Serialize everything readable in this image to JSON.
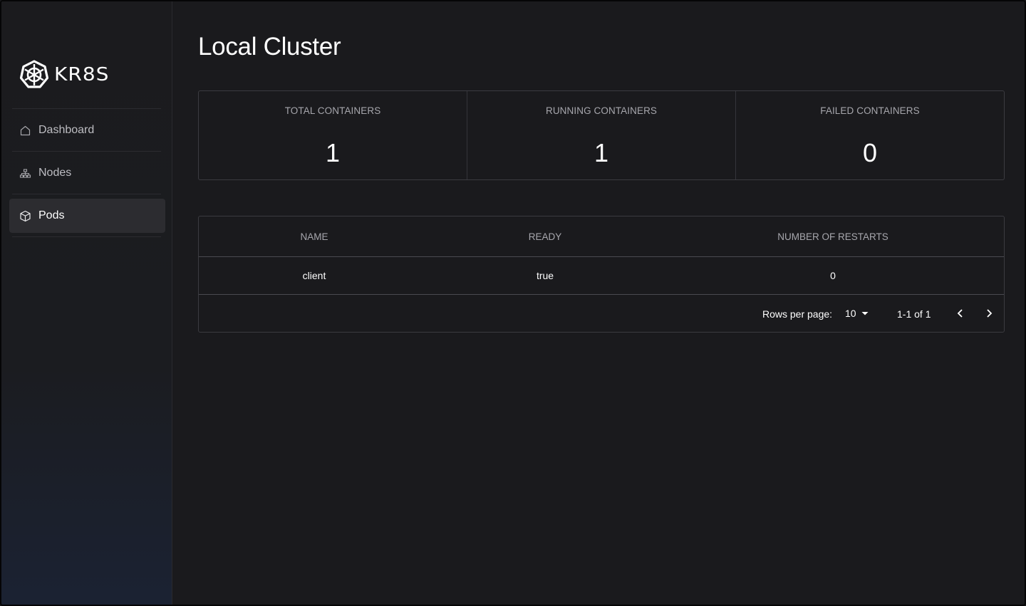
{
  "brand": {
    "logo_text": "KR8S"
  },
  "sidebar": {
    "items": [
      {
        "label": "Dashboard",
        "icon": "home-icon",
        "active": false
      },
      {
        "label": "Nodes",
        "icon": "nodes-icon",
        "active": false
      },
      {
        "label": "Pods",
        "icon": "cube-icon",
        "active": true
      }
    ]
  },
  "page": {
    "title": "Local Cluster"
  },
  "stats": [
    {
      "label": "TOTAL CONTAINERS",
      "value": "1"
    },
    {
      "label": "RUNNING CONTAINERS",
      "value": "1"
    },
    {
      "label": "FAILED CONTAINERS",
      "value": "0"
    }
  ],
  "table": {
    "columns": [
      "NAME",
      "READY",
      "NUMBER OF RESTARTS"
    ],
    "rows": [
      [
        "client",
        "true",
        "0"
      ]
    ]
  },
  "pagination": {
    "rows_per_page_label": "Rows per page:",
    "rows_per_page_value": "10",
    "range": "1-1 of 1"
  },
  "colors": {
    "background": "#1a1a1d",
    "sidebar_bg": "#1b1b1e",
    "active_item_bg": "#2c2c30",
    "border": "#3b3b40",
    "muted_text": "#a7a7ad"
  }
}
